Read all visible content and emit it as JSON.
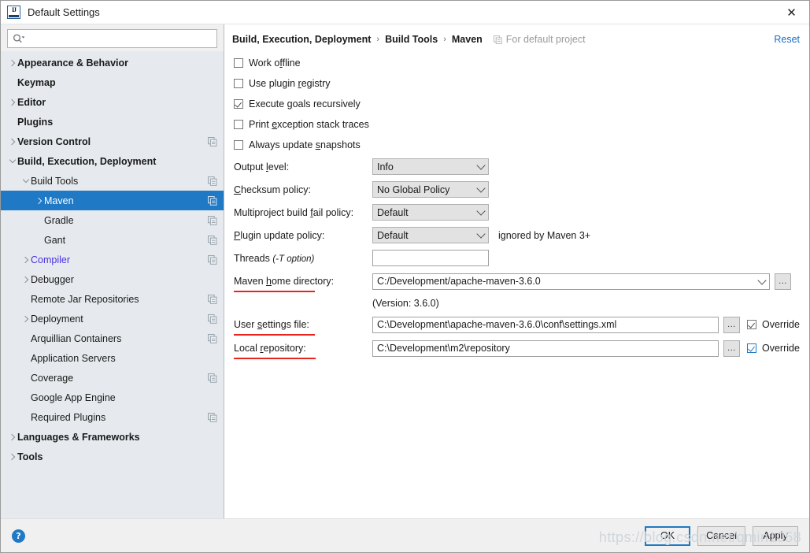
{
  "window": {
    "title": "Default Settings",
    "logo_icon": "intellij-idea-icon",
    "close_icon": "close-icon"
  },
  "search": {
    "value": "",
    "placeholder": "",
    "icon": "search-icon"
  },
  "sidebar": {
    "items": [
      {
        "label": "Appearance & Behavior",
        "indent": 0,
        "arrow": "right",
        "bold": true,
        "copy_icon": false,
        "selected": false,
        "modified": false
      },
      {
        "label": "Keymap",
        "indent": 0,
        "arrow": "none",
        "bold": true,
        "copy_icon": false,
        "selected": false,
        "modified": false
      },
      {
        "label": "Editor",
        "indent": 0,
        "arrow": "right",
        "bold": true,
        "copy_icon": false,
        "selected": false,
        "modified": false
      },
      {
        "label": "Plugins",
        "indent": 0,
        "arrow": "none",
        "bold": true,
        "copy_icon": false,
        "selected": false,
        "modified": false
      },
      {
        "label": "Version Control",
        "indent": 0,
        "arrow": "right",
        "bold": true,
        "copy_icon": true,
        "selected": false,
        "modified": false
      },
      {
        "label": "Build, Execution, Deployment",
        "indent": 0,
        "arrow": "down",
        "bold": true,
        "copy_icon": false,
        "selected": false,
        "modified": false
      },
      {
        "label": "Build Tools",
        "indent": 1,
        "arrow": "down",
        "bold": false,
        "copy_icon": true,
        "selected": false,
        "modified": false
      },
      {
        "label": "Maven",
        "indent": 2,
        "arrow": "right",
        "bold": false,
        "copy_icon": true,
        "selected": true,
        "modified": false
      },
      {
        "label": "Gradle",
        "indent": 2,
        "arrow": "none",
        "bold": false,
        "copy_icon": true,
        "selected": false,
        "modified": false
      },
      {
        "label": "Gant",
        "indent": 2,
        "arrow": "none",
        "bold": false,
        "copy_icon": true,
        "selected": false,
        "modified": false
      },
      {
        "label": "Compiler",
        "indent": 1,
        "arrow": "right",
        "bold": false,
        "copy_icon": true,
        "selected": false,
        "modified": true
      },
      {
        "label": "Debugger",
        "indent": 1,
        "arrow": "right",
        "bold": false,
        "copy_icon": false,
        "selected": false,
        "modified": false
      },
      {
        "label": "Remote Jar Repositories",
        "indent": 1,
        "arrow": "none",
        "bold": false,
        "copy_icon": true,
        "selected": false,
        "modified": false
      },
      {
        "label": "Deployment",
        "indent": 1,
        "arrow": "right",
        "bold": false,
        "copy_icon": true,
        "selected": false,
        "modified": false
      },
      {
        "label": "Arquillian Containers",
        "indent": 1,
        "arrow": "none",
        "bold": false,
        "copy_icon": true,
        "selected": false,
        "modified": false
      },
      {
        "label": "Application Servers",
        "indent": 1,
        "arrow": "none",
        "bold": false,
        "copy_icon": false,
        "selected": false,
        "modified": false
      },
      {
        "label": "Coverage",
        "indent": 1,
        "arrow": "none",
        "bold": false,
        "copy_icon": true,
        "selected": false,
        "modified": false
      },
      {
        "label": "Google App Engine",
        "indent": 1,
        "arrow": "none",
        "bold": false,
        "copy_icon": false,
        "selected": false,
        "modified": false
      },
      {
        "label": "Required Plugins",
        "indent": 1,
        "arrow": "none",
        "bold": false,
        "copy_icon": true,
        "selected": false,
        "modified": false
      },
      {
        "label": "Languages & Frameworks",
        "indent": 0,
        "arrow": "right",
        "bold": true,
        "copy_icon": false,
        "selected": false,
        "modified": false
      },
      {
        "label": "Tools",
        "indent": 0,
        "arrow": "right",
        "bold": true,
        "copy_icon": false,
        "selected": false,
        "modified": false
      }
    ]
  },
  "header": {
    "crumb1": "Build, Execution, Deployment",
    "crumb2": "Build Tools",
    "crumb3": "Maven",
    "separator": "›",
    "scope_label": "For default project",
    "scope_icon": "copy-settings-icon",
    "reset_label": "Reset"
  },
  "main": {
    "checkboxes": [
      {
        "pre": "Work o",
        "mnemonic": "f",
        "post": "fline",
        "checked": false
      },
      {
        "pre": "Use plugin ",
        "mnemonic": "r",
        "post": "egistry",
        "checked": false
      },
      {
        "pre": "Execute ",
        "mnemonic": "g",
        "post": "oals recursively",
        "checked": true
      },
      {
        "pre": "Print ",
        "mnemonic": "e",
        "post": "xception stack traces",
        "checked": false
      },
      {
        "pre": "Always update ",
        "mnemonic": "s",
        "post": "napshots",
        "checked": false
      }
    ],
    "combos": [
      {
        "pre": "Output ",
        "mnemonic": "l",
        "post": "evel:",
        "value": "Info"
      },
      {
        "pre": "",
        "mnemonic": "C",
        "post": "hecksum policy:",
        "value": "No Global Policy"
      },
      {
        "pre": "Multiproject build ",
        "mnemonic": "f",
        "post": "ail policy:",
        "value": "Default"
      },
      {
        "pre": "",
        "mnemonic": "P",
        "post": "lugin update policy:",
        "value": "Default",
        "note": "ignored by Maven 3+"
      }
    ],
    "threads": {
      "label": "Threads",
      "hint": "(-T option)",
      "value": ""
    },
    "maven_home": {
      "pre": "Maven ",
      "mnemonic": "h",
      "post": "ome directory:",
      "value": "C:/Development/apache-maven-3.6.0",
      "browse_label": "...",
      "version_note": "(Version: 3.6.0)"
    },
    "user_settings": {
      "pre": "User ",
      "mnemonic": "s",
      "post": "ettings file:",
      "value": "C:\\Development\\apache-maven-3.6.0\\conf\\settings.xml",
      "browse_label": "...",
      "override_label": "Override",
      "override_checked": true,
      "override_focused": false
    },
    "local_repo": {
      "pre": "Local ",
      "mnemonic": "r",
      "post": "epository:",
      "value": "C:\\Development\\m2\\repository",
      "browse_label": "...",
      "override_label": "Override",
      "override_checked": true,
      "override_focused": true
    }
  },
  "footer": {
    "help_icon": "help-icon",
    "help_glyph": "?",
    "ok_label": "OK",
    "cancel_label": "Cancel",
    "apply_label": "Apply"
  },
  "watermark": {
    "text": "https://blog.csdn.net/qmin1058"
  },
  "colors": {
    "selection_blue": "#1f79c4",
    "link_blue": "#1a6fc4",
    "modified_violet": "#4a30e0",
    "annotation_red": "#e8241f",
    "sidebar_bg": "#e6eaee"
  }
}
